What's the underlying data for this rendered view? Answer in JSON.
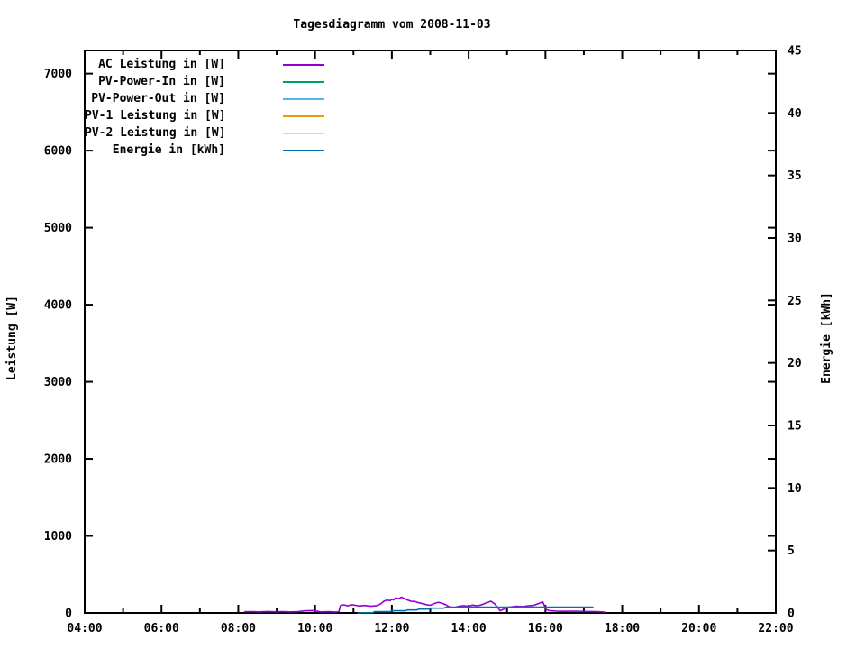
{
  "chart_data": {
    "type": "line",
    "title": "Tagesdiagramm vom 2008-11-03",
    "xlabel": "",
    "ylabel": "Leistung [W]",
    "y2label": "Energie [kWh]",
    "xlim": [
      4,
      22
    ],
    "ylim": [
      0,
      7300
    ],
    "y2lim": [
      0,
      45
    ],
    "grid": false,
    "x_major_ticks": [
      4,
      6,
      8,
      10,
      12,
      14,
      16,
      18,
      20,
      22
    ],
    "x_major_tick_labels": [
      "04:00",
      "06:00",
      "08:00",
      "10:00",
      "12:00",
      "14:00",
      "16:00",
      "18:00",
      "20:00",
      "22:00"
    ],
    "x_minor_ticks": [
      5,
      7,
      9,
      11,
      13,
      15,
      17,
      19,
      21
    ],
    "y_ticks": [
      0,
      1000,
      2000,
      3000,
      4000,
      5000,
      6000,
      7000
    ],
    "y_tick_labels": [
      "0",
      "1000",
      "2000",
      "3000",
      "4000",
      "5000",
      "6000",
      "7000"
    ],
    "y2_ticks": [
      0,
      5,
      10,
      15,
      20,
      25,
      30,
      35,
      40,
      45
    ],
    "y2_tick_labels": [
      "0",
      "5",
      "10",
      "15",
      "20",
      "25",
      "30",
      "35",
      "40",
      "45"
    ],
    "legend_position": "top-left-inside",
    "legend": [
      {
        "label": "AC Leistung in [W]",
        "color": "#9400d3"
      },
      {
        "label": "PV-Power-In in [W]",
        "color": "#009e73"
      },
      {
        "label": "PV-Power-Out in [W]",
        "color": "#56b4e9"
      },
      {
        "label": "PV-1 Leistung in [W]",
        "color": "#e69f00"
      },
      {
        "label": "PV-2 Leistung in [W]",
        "color": "#f0e442"
      },
      {
        "label": "Energie in [kWh]",
        "color": "#0072b2"
      }
    ],
    "series": [
      {
        "name": "AC Leistung in [W]",
        "color": "#9400d3",
        "axis": "y",
        "unit": "W",
        "points": [
          [
            8.15,
            15
          ],
          [
            8.35,
            18
          ],
          [
            8.55,
            14
          ],
          [
            8.75,
            19
          ],
          [
            8.95,
            15
          ],
          [
            9.15,
            18
          ],
          [
            9.35,
            14
          ],
          [
            9.55,
            16
          ],
          [
            9.75,
            28
          ],
          [
            9.95,
            30
          ],
          [
            10.05,
            22
          ],
          [
            10.15,
            14
          ],
          [
            10.35,
            16
          ],
          [
            10.55,
            13
          ],
          [
            10.62,
            18
          ],
          [
            10.66,
            95
          ],
          [
            10.75,
            105
          ],
          [
            10.85,
            93
          ],
          [
            10.95,
            108
          ],
          [
            11.05,
            100
          ],
          [
            11.15,
            90
          ],
          [
            11.3,
            97
          ],
          [
            11.45,
            86
          ],
          [
            11.6,
            95
          ],
          [
            11.7,
            115
          ],
          [
            11.8,
            155
          ],
          [
            11.88,
            168
          ],
          [
            11.95,
            158
          ],
          [
            12.0,
            180
          ],
          [
            12.05,
            170
          ],
          [
            12.1,
            195
          ],
          [
            12.18,
            185
          ],
          [
            12.25,
            205
          ],
          [
            12.32,
            190
          ],
          [
            12.4,
            170
          ],
          [
            12.5,
            152
          ],
          [
            12.6,
            148
          ],
          [
            12.7,
            132
          ],
          [
            12.8,
            120
          ],
          [
            12.9,
            108
          ],
          [
            13.0,
            100
          ],
          [
            13.1,
            122
          ],
          [
            13.2,
            138
          ],
          [
            13.3,
            128
          ],
          [
            13.4,
            108
          ],
          [
            13.5,
            78
          ],
          [
            13.62,
            68
          ],
          [
            13.75,
            88
          ],
          [
            13.88,
            95
          ],
          [
            14.0,
            84
          ],
          [
            14.1,
            102
          ],
          [
            14.22,
            92
          ],
          [
            14.35,
            108
          ],
          [
            14.48,
            135
          ],
          [
            14.58,
            152
          ],
          [
            14.68,
            118
          ],
          [
            14.82,
            28
          ],
          [
            14.95,
            58
          ],
          [
            15.1,
            78
          ],
          [
            15.25,
            88
          ],
          [
            15.4,
            83
          ],
          [
            15.55,
            93
          ],
          [
            15.7,
            99
          ],
          [
            15.85,
            128
          ],
          [
            15.93,
            143
          ],
          [
            16.02,
            45
          ],
          [
            16.1,
            30
          ],
          [
            16.25,
            24
          ],
          [
            16.5,
            21
          ],
          [
            16.8,
            23
          ],
          [
            17.1,
            19
          ],
          [
            17.35,
            16
          ],
          [
            17.55,
            12
          ]
        ]
      },
      {
        "name": "PV-Power-In in [W]",
        "color": "#009e73",
        "axis": "y",
        "unit": "W",
        "points": []
      },
      {
        "name": "PV-Power-Out in [W]",
        "color": "#56b4e9",
        "axis": "y",
        "unit": "W",
        "points": []
      },
      {
        "name": "PV-1 Leistung in [W]",
        "color": "#e69f00",
        "axis": "y",
        "unit": "W",
        "points": []
      },
      {
        "name": "PV-2 Leistung in [W]",
        "color": "#f0e442",
        "axis": "y",
        "unit": "W",
        "points": []
      },
      {
        "name": "Energie in [kWh]",
        "color": "#0072b2",
        "axis": "y2",
        "unit": "kWh",
        "points": [
          [
            11.1,
            0.0
          ],
          [
            11.5,
            0.02
          ],
          [
            11.55,
            0.1
          ],
          [
            11.95,
            0.1
          ],
          [
            12.0,
            0.17
          ],
          [
            12.35,
            0.17
          ],
          [
            12.4,
            0.24
          ],
          [
            12.65,
            0.24
          ],
          [
            12.7,
            0.31
          ],
          [
            12.95,
            0.31
          ],
          [
            13.0,
            0.38
          ],
          [
            13.35,
            0.38
          ],
          [
            13.4,
            0.45
          ],
          [
            13.55,
            0.47
          ],
          [
            17.25,
            0.47
          ]
        ]
      }
    ]
  }
}
